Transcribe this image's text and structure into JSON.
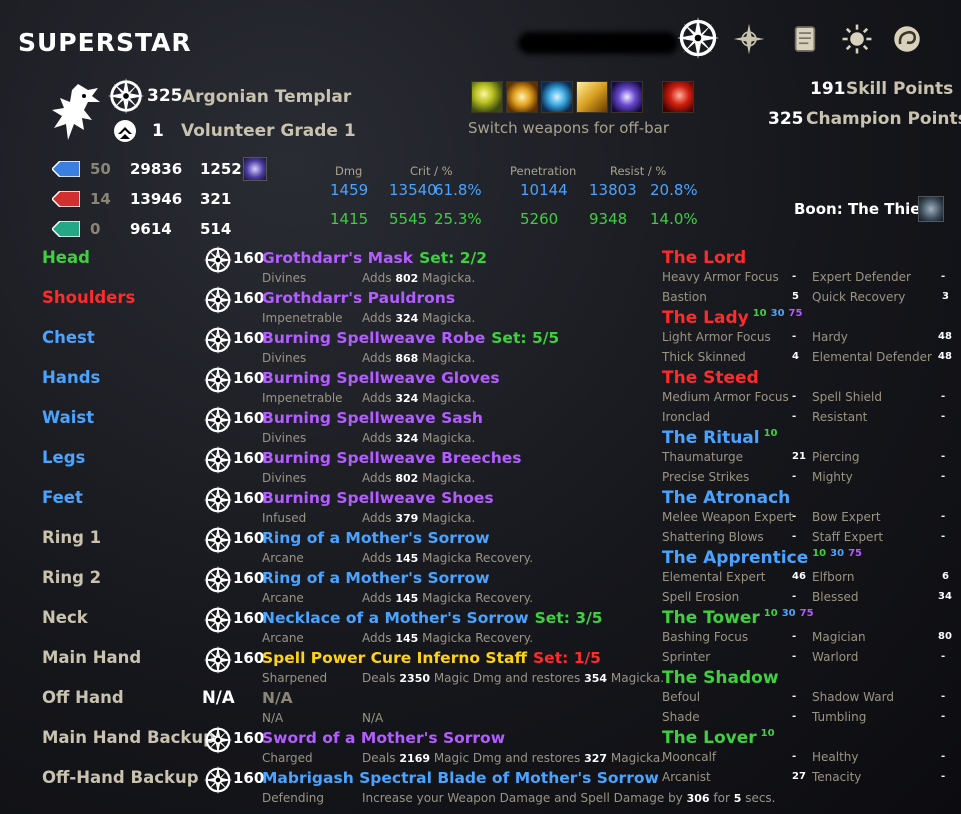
{
  "title": "SUPERSTAR",
  "nav_icons": [
    "champion-icon",
    "skills-compass-icon",
    "scroll-icon",
    "sun-icon",
    "spiral-icon"
  ],
  "character": {
    "champion_level": "325",
    "race_class": "Argonian Templar",
    "alliance_rank": "1",
    "rank_title": "Volunteer Grade 1",
    "weapon_hint": "Switch weapons for off-bar"
  },
  "points": {
    "skill_value": "191",
    "skill_label": "Skill Points",
    "champion_value": "325",
    "champion_label": "Champion Points"
  },
  "resources": [
    {
      "color": "#3a7ee0",
      "pts": "50",
      "max": "29836",
      "regen": "1252"
    },
    {
      "color": "#d03030",
      "pts": "14",
      "max": "13946",
      "regen": "321"
    },
    {
      "color": "#23a784",
      "pts": "0",
      "max": "9614",
      "regen": "514"
    }
  ],
  "stats_headers": {
    "dmg": "Dmg",
    "crit": "Crit / %",
    "pen": "Penetration",
    "resist": "Resist / %"
  },
  "stats_rows": [
    {
      "dmg": "1459",
      "crit": "13540",
      "critp": "61.8%",
      "pen": "10144",
      "res": "13803",
      "resp": "20.8%"
    },
    {
      "dmg": "1415",
      "crit": "5545",
      "critp": "25.3%",
      "pen": "5260",
      "res": "9348",
      "resp": "14.0%"
    }
  ],
  "boon": "Boon: The Thief",
  "gear": [
    {
      "slot": "Head",
      "slot_color": "#3fcf3f",
      "lvl": "160",
      "name": "Grothdarr's Mask",
      "name_color": "#b35cff",
      "set": "Set: 2/2",
      "set_color": "#3fcf3f",
      "trait": "Divines",
      "pre": "Adds ",
      "num1": "802",
      "mid": " Magicka.",
      "num2": "",
      "post": ""
    },
    {
      "slot": "Shoulders",
      "slot_color": "#ff2a2a",
      "lvl": "160",
      "name": "Grothdarr's Pauldrons",
      "name_color": "#b35cff",
      "set": "",
      "set_color": "#3fcf3f",
      "trait": "Impenetrable",
      "pre": "Adds ",
      "num1": "324",
      "mid": " Magicka.",
      "num2": "",
      "post": ""
    },
    {
      "slot": "Chest",
      "slot_color": "#4aa3ff",
      "lvl": "160",
      "name": "Burning Spellweave Robe",
      "name_color": "#b35cff",
      "set": "Set: 5/5",
      "set_color": "#3fcf3f",
      "trait": "Divines",
      "pre": "Adds ",
      "num1": "868",
      "mid": " Magicka.",
      "num2": "",
      "post": ""
    },
    {
      "slot": "Hands",
      "slot_color": "#4aa3ff",
      "lvl": "160",
      "name": "Burning Spellweave Gloves",
      "name_color": "#b35cff",
      "set": "",
      "set_color": "#3fcf3f",
      "trait": "Impenetrable",
      "pre": "Adds ",
      "num1": "324",
      "mid": " Magicka.",
      "num2": "",
      "post": ""
    },
    {
      "slot": "Waist",
      "slot_color": "#4aa3ff",
      "lvl": "160",
      "name": "Burning Spellweave Sash",
      "name_color": "#b35cff",
      "set": "",
      "set_color": "#3fcf3f",
      "trait": "Divines",
      "pre": "Adds ",
      "num1": "324",
      "mid": " Magicka.",
      "num2": "",
      "post": ""
    },
    {
      "slot": "Legs",
      "slot_color": "#4aa3ff",
      "lvl": "160",
      "name": "Burning Spellweave Breeches",
      "name_color": "#b35cff",
      "set": "",
      "set_color": "#3fcf3f",
      "trait": "Divines",
      "pre": "Adds ",
      "num1": "802",
      "mid": " Magicka.",
      "num2": "",
      "post": ""
    },
    {
      "slot": "Feet",
      "slot_color": "#4aa3ff",
      "lvl": "160",
      "name": "Burning Spellweave Shoes",
      "name_color": "#b35cff",
      "set": "",
      "set_color": "#3fcf3f",
      "trait": "Infused",
      "pre": "Adds ",
      "num1": "379",
      "mid": " Magicka.",
      "num2": "",
      "post": ""
    },
    {
      "slot": "Ring 1",
      "slot_color": "#c9c2ae",
      "lvl": "160",
      "name": "Ring of a Mother's Sorrow",
      "name_color": "#4aa3ff",
      "set": "",
      "set_color": "#3fcf3f",
      "trait": "Arcane",
      "pre": "Adds ",
      "num1": "145",
      "mid": " Magicka Recovery.",
      "num2": "",
      "post": ""
    },
    {
      "slot": "Ring 2",
      "slot_color": "#c9c2ae",
      "lvl": "160",
      "name": "Ring of a Mother's Sorrow",
      "name_color": "#4aa3ff",
      "set": "",
      "set_color": "#3fcf3f",
      "trait": "Arcane",
      "pre": "Adds ",
      "num1": "145",
      "mid": " Magicka Recovery.",
      "num2": "",
      "post": ""
    },
    {
      "slot": "Neck",
      "slot_color": "#c9c2ae",
      "lvl": "160",
      "name": "Necklace of a Mother's Sorrow",
      "name_color": "#4aa3ff",
      "set": "Set: 3/5",
      "set_color": "#3fcf3f",
      "trait": "Arcane",
      "pre": "Adds ",
      "num1": "145",
      "mid": " Magicka Recovery.",
      "num2": "",
      "post": ""
    },
    {
      "slot": "Main Hand",
      "slot_color": "#c9c2ae",
      "lvl": "160",
      "name": "Spell Power Cure Inferno Staff",
      "name_color": "#ffd21a",
      "set": "Set: 1/5",
      "set_color": "#ff2a2a",
      "trait": "Sharpened",
      "pre": "Deals ",
      "num1": "2350",
      "mid": " Magic Dmg and restores ",
      "num2": "354",
      "post": " Magicka."
    },
    {
      "slot": "Off Hand",
      "slot_color": "#c9c2ae",
      "lvl": "N/A",
      "name": "N/A",
      "name_color": "#8a8576",
      "set": "",
      "set_color": "#3fcf3f",
      "trait": "N/A",
      "pre": "N/A",
      "num1": "",
      "mid": "",
      "num2": "",
      "post": ""
    },
    {
      "slot": "Main Hand Backup",
      "slot_color": "#c9c2ae",
      "lvl": "160",
      "name": "Sword of a Mother's Sorrow",
      "name_color": "#b35cff",
      "set": "",
      "set_color": "#3fcf3f",
      "trait": "Charged",
      "pre": "Deals ",
      "num1": "2169",
      "mid": " Magic Dmg and restores ",
      "num2": "327",
      "post": " Magicka."
    },
    {
      "slot": "Off-Hand Backup",
      "slot_color": "#c9c2ae",
      "lvl": "160",
      "name": "Mabrigash Spectral Blade of Mother's Sorrow",
      "name_color": "#4aa3ff",
      "set": "",
      "set_color": "#3fcf3f",
      "trait": "Defending",
      "pre": "Increase your Weapon Damage and Spell Damage by ",
      "num1": "306",
      "mid": " for ",
      "num2": "5",
      "post": " secs."
    }
  ],
  "constellations": [
    {
      "name": "The Lord",
      "color": "#ff2a2a",
      "sup": [],
      "stars": [
        [
          "Heavy Armor Focus",
          "-",
          "Expert Defender",
          "-"
        ],
        [
          "Bastion",
          "5",
          "Quick Recovery",
          "3"
        ]
      ]
    },
    {
      "name": "The Lady",
      "color": "#ff2a2a",
      "sup": [
        {
          "v": "10",
          "c": "#3fcf3f"
        },
        {
          "v": "30",
          "c": "#4aa3ff"
        },
        {
          "v": "75",
          "c": "#b35cff"
        }
      ],
      "stars": [
        [
          "Light Armor Focus",
          "-",
          "Hardy",
          "48"
        ],
        [
          "Thick Skinned",
          "4",
          "Elemental Defender",
          "48"
        ]
      ]
    },
    {
      "name": "The Steed",
      "color": "#ff2a2a",
      "sup": [],
      "stars": [
        [
          "Medium Armor Focus",
          "-",
          "Spell Shield",
          "-"
        ],
        [
          "Ironclad",
          "-",
          "Resistant",
          "-"
        ]
      ]
    },
    {
      "name": "The Ritual",
      "color": "#4aa3ff",
      "sup": [
        {
          "v": "10",
          "c": "#3fcf3f"
        }
      ],
      "stars": [
        [
          "Thaumaturge",
          "21",
          "Piercing",
          "-"
        ],
        [
          "Precise Strikes",
          "-",
          "Mighty",
          "-"
        ]
      ]
    },
    {
      "name": "The Atronach",
      "color": "#4aa3ff",
      "sup": [],
      "stars": [
        [
          "Melee Weapon Expert",
          "-",
          "Bow Expert",
          "-"
        ],
        [
          "Shattering Blows",
          "-",
          "Staff Expert",
          "-"
        ]
      ]
    },
    {
      "name": "The Apprentice",
      "color": "#4aa3ff",
      "sup": [
        {
          "v": "10",
          "c": "#3fcf3f"
        },
        {
          "v": "30",
          "c": "#4aa3ff"
        },
        {
          "v": "75",
          "c": "#b35cff"
        }
      ],
      "stars": [
        [
          "Elemental Expert",
          "46",
          "Elfborn",
          "6"
        ],
        [
          "Spell Erosion",
          "-",
          "Blessed",
          "34"
        ]
      ]
    },
    {
      "name": "The Tower",
      "color": "#3fcf3f",
      "sup": [
        {
          "v": "10",
          "c": "#3fcf3f"
        },
        {
          "v": "30",
          "c": "#4aa3ff"
        },
        {
          "v": "75",
          "c": "#b35cff"
        }
      ],
      "stars": [
        [
          "Bashing Focus",
          "-",
          "Magician",
          "80"
        ],
        [
          "Sprinter",
          "-",
          "Warlord",
          "-"
        ]
      ]
    },
    {
      "name": "The Shadow",
      "color": "#3fcf3f",
      "sup": [],
      "stars": [
        [
          "Befoul",
          "-",
          "Shadow Ward",
          "-"
        ],
        [
          "Shade",
          "-",
          "Tumbling",
          "-"
        ]
      ]
    },
    {
      "name": "The Lover",
      "color": "#3fcf3f",
      "sup": [
        {
          "v": "10",
          "c": "#3fcf3f"
        }
      ],
      "stars": [
        [
          "Mooncalf",
          "-",
          "Healthy",
          "-"
        ],
        [
          "Arcanist",
          "27",
          "Tenacity",
          "-"
        ]
      ]
    }
  ]
}
